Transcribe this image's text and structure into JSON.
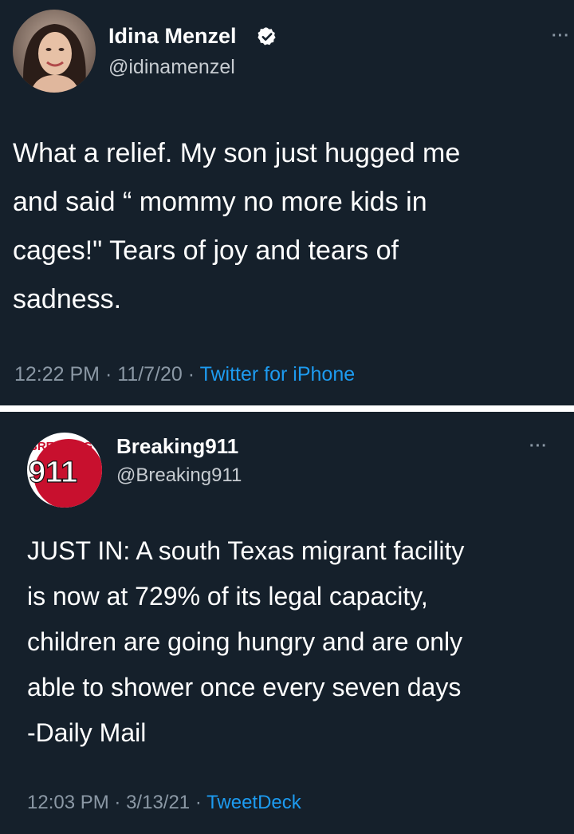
{
  "tweets": [
    {
      "display_name": "Idina Menzel",
      "verified": true,
      "handle": "@idinamenzel",
      "more_label": "···",
      "body_lines": [
        "What a relief.  My son just hugged me",
        "and said “ mommy no more kids in",
        "cages!\" Tears of joy and tears of",
        "sadness."
      ],
      "time": "12:22 PM",
      "date": "11/7/20",
      "source": "Twitter for iPhone"
    },
    {
      "display_name": "Breaking911",
      "verified": false,
      "handle": "@Breaking911",
      "more_label": "···",
      "avatar_logo": {
        "top_text": "BREAKING",
        "number": "911"
      },
      "body_lines": [
        "JUST IN: A south Texas migrant facility",
        "is now at 729% of its legal capacity,",
        "children are going hungry and are only",
        "able to shower once every seven days",
        "-Daily Mail"
      ],
      "time": "12:03 PM",
      "date": "3/13/21",
      "source": "TweetDeck"
    }
  ],
  "colors": {
    "background": "#15202b",
    "text": "#ffffff",
    "secondary": "#8b98a5",
    "link": "#1d9bf0",
    "verified": "#ffffff",
    "logo_red": "#c8102e"
  },
  "icons": {
    "verified": "verified-badge-icon",
    "more": "more-options-icon"
  }
}
